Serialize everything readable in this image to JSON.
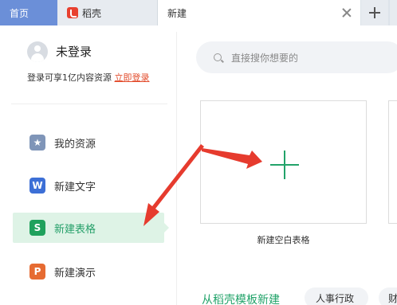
{
  "tabs": {
    "home": "首页",
    "docer": "稻壳",
    "new": "新建"
  },
  "sidebar": {
    "username": "未登录",
    "login_hint": "登录可享1亿内容资源",
    "login_link": "立即登录",
    "items": [
      {
        "label": "我的资源",
        "icon": "star-icon",
        "glyph": "★",
        "color": "#7f95b8"
      },
      {
        "label": "新建文字",
        "icon": "writer-icon",
        "glyph": "W",
        "color": "#3c6fd6"
      },
      {
        "label": "新建表格",
        "icon": "spreadsheet-icon",
        "glyph": "S",
        "color": "#1fa15c"
      },
      {
        "label": "新建演示",
        "icon": "presentation-icon",
        "glyph": "P",
        "color": "#e66b32"
      }
    ],
    "selected": "新建表格"
  },
  "search": {
    "placeholder": "直接搜你想要的"
  },
  "main": {
    "blank_card_label": "新建空白表格",
    "template_heading": "从稻壳模板新建",
    "chips": [
      "人事行政",
      "财"
    ]
  },
  "colors": {
    "accent": "#22a36a",
    "annotation": "#e63b2e",
    "home_tab": "#6b8fd8"
  }
}
